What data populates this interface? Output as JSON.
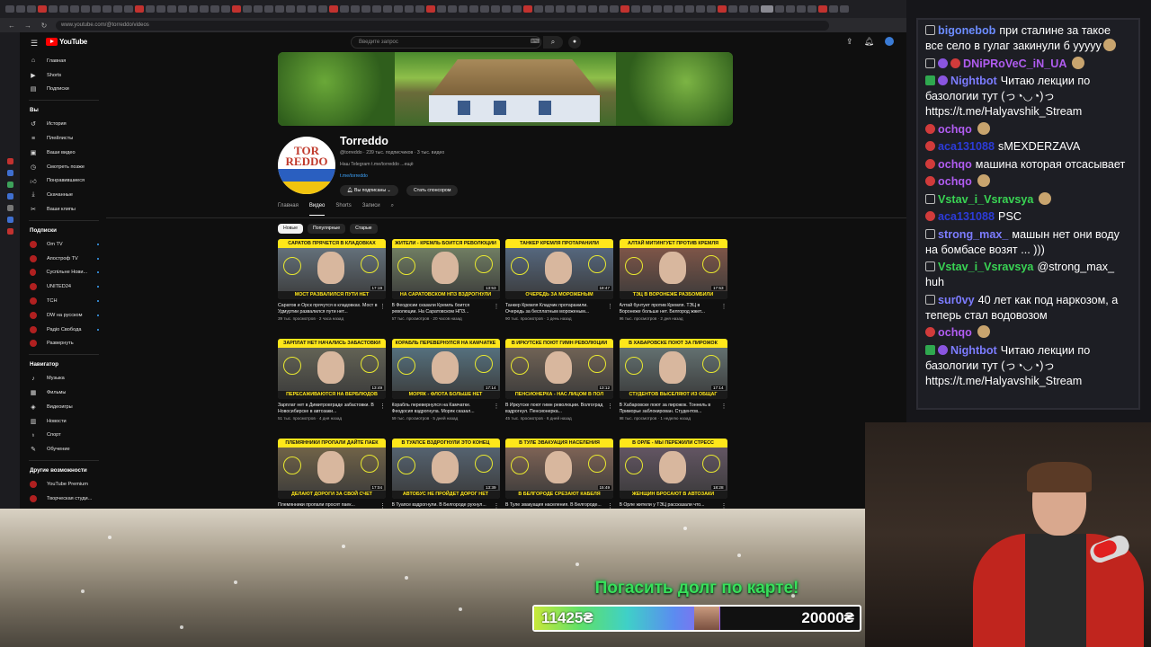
{
  "browser": {
    "url": "www.youtube.com/@torreddo/videos"
  },
  "youtube": {
    "logo_text": "YouTube",
    "search_placeholder": "Введите запрос",
    "sidebar": {
      "main": [
        {
          "label": "Главная",
          "icon": "home-icon"
        },
        {
          "label": "Shorts",
          "icon": "shorts-icon"
        },
        {
          "label": "Подписки",
          "icon": "subscriptions-icon"
        }
      ],
      "you_heading": "Вы",
      "you": [
        {
          "label": "История",
          "icon": "history-icon"
        },
        {
          "label": "Плейлисты",
          "icon": "playlists-icon"
        },
        {
          "label": "Ваши видео",
          "icon": "your-videos-icon"
        },
        {
          "label": "Смотреть позже",
          "icon": "watch-later-icon"
        },
        {
          "label": "Понравившиеся",
          "icon": "liked-icon"
        },
        {
          "label": "Скачанные",
          "icon": "downloads-icon"
        },
        {
          "label": "Ваши клипы",
          "icon": "clips-icon"
        }
      ],
      "subs_heading": "Подписки",
      "subs": [
        {
          "label": "Om TV"
        },
        {
          "label": "Апостроф TV"
        },
        {
          "label": "Суспільне Нови..."
        },
        {
          "label": "UNITED24"
        },
        {
          "label": "ТСН"
        },
        {
          "label": "DW на русском"
        },
        {
          "label": "Радіо Свобода"
        },
        {
          "label": "Развернуть"
        }
      ],
      "nav_heading": "Навигатор",
      "nav": [
        {
          "label": "Музыка",
          "icon": "music-icon"
        },
        {
          "label": "Фильмы",
          "icon": "movies-icon"
        },
        {
          "label": "Видеоигры",
          "icon": "gaming-icon"
        },
        {
          "label": "Новости",
          "icon": "news-icon"
        },
        {
          "label": "Спорт",
          "icon": "sports-icon"
        },
        {
          "label": "Обучение",
          "icon": "learning-icon"
        }
      ],
      "more_heading": "Другие возможности",
      "more": [
        {
          "label": "YouTube Premium"
        },
        {
          "label": "Творческая студи..."
        }
      ]
    },
    "channel": {
      "name": "Torreddo",
      "avatar_text": "TOR REDDO",
      "meta": "@torreddo · 239 тыс. подписчиков · 3 тыс. видео",
      "description": "Наш Telegram t.me/torreddo ...ещё",
      "link": "t.me/torreddo",
      "subscribed_label": "Вы подписаны",
      "sponsor_label": "Стать спонсором",
      "tabs": [
        "Главная",
        "Видео",
        "Shorts",
        "Записи"
      ],
      "active_tab": "Видео",
      "chips": [
        "Новые",
        "Популярные",
        "Старые"
      ]
    },
    "videos": [
      {
        "thumb_top": "САРАТОВ ПРЯЧЕТСЯ В КЛАДОВКАХ",
        "thumb_bottom": "МОСТ РАЗВАЛИЛСЯ ПУТИ НЕТ",
        "duration": "17:19",
        "title": "Саратов и Орск прячутся в кладовках. Мост в Удмуртии развалился пути нет...",
        "meta": "39 тыс. просмотров · 2 часа назад"
      },
      {
        "thumb_top": "ЖИТЕЛИ - КРЕМЛЬ БОИТСЯ РЕВОЛЮЦИИ",
        "thumb_bottom": "НА САРАТОВСКОМ НПЗ ВЗДРОГНУЛИ",
        "duration": "13:53",
        "title": "В Феодосии сказали Кремль боится революции. На Саратовском НПЗ...",
        "meta": "57 тыс. просмотров · 20 часов назад"
      },
      {
        "thumb_top": "ТАНКЕР КРЕМЛЯ ПРОТАРАНИЛИ",
        "thumb_bottom": "ОЧЕРЕДЬ ЗА МОРОЖЕНЫМ",
        "duration": "18:47",
        "title": "Танкер Кремля Кладчик протаранили. Очередь за бесплатным мороженым...",
        "meta": "90 тыс. просмотров · 1 день назад"
      },
      {
        "thumb_top": "АЛТАЙ МИТИНГУЕТ ПРОТИВ КРЕМЛЯ",
        "thumb_bottom": "ТЭЦ В ВОРОНЕЖЕ РАЗБОМБИЛИ",
        "duration": "17:53",
        "title": "Алтай бунтует против Кремля. ТЭЦ в Воронеже больше нет. Белгород жжет...",
        "meta": "96 тыс. просмотров · 2 дня назад"
      },
      {
        "thumb_top": "ЗАРПЛАТ НЕТ НАЧАЛИСЬ ЗАБАСТОВКИ",
        "thumb_bottom": "ПЕРЕСАЖИВАЮТСЯ НА ВЕРБЛЮДОВ",
        "duration": "13:49",
        "title": "Зарплат нет в Димитровграде забастовки. В Новосибирске в автозаки...",
        "meta": "51 тыс. просмотров · 4 дня назад"
      },
      {
        "thumb_top": "КОРАБЛЬ ПЕРЕВЕРНУЛСЯ НА КАМЧАТКЕ",
        "thumb_bottom": "МОРЯК - ФЛОТА БОЛЬШЕ НЕТ",
        "duration": "17:14",
        "title": "Корабль перевернулся на Камчатке. Феодосия вздрогнула. Моряк сказал...",
        "meta": "59 тыс. просмотров · 5 дней назад"
      },
      {
        "thumb_top": "В ИРКУТСКЕ ПОЮТ ГИМН РЕВОЛЮЦИИ",
        "thumb_bottom": "ПЕНСИОНЕРКА - НАС ЛИЦОМ В ПОЛ",
        "duration": "13:12",
        "title": "В Иркутске поют гимн революции. Волгоград вздрогнул. Пенсионерка...",
        "meta": "45 тыс. просмотров · 6 дней назад"
      },
      {
        "thumb_top": "В ХАБАРОВСКЕ ПОЮТ ЗА ПИРОЖОК",
        "thumb_bottom": "СТУДЕНТОВ ВЫСЕЛЯЮТ ИЗ ОБЩАГ",
        "duration": "17:14",
        "title": "В Хабаровске поют за пирожок. Тоннель в Приморье заблокирован. Студентов...",
        "meta": "98 тыс. просмотров · 1 неделю назад"
      },
      {
        "thumb_top": "ПЛЕМЯННИКИ ПРОПАЛИ ДАЙТЕ ПАЕК",
        "thumb_bottom": "ДЕЛАЮТ ДОРОГИ ЗА СВОЙ СЧЕТ",
        "duration": "17:04",
        "title": "Племянники пропали просят паек...",
        "meta": ""
      },
      {
        "thumb_top": "В ТУАПСЕ ВЗДРОГНУЛИ ЭТО КОНЕЦ",
        "thumb_bottom": "АВТОБУС НЕ ПРОЙДЕТ ДОРОГ НЕТ",
        "duration": "13:39",
        "title": "В Туапсе вздрогнули. В Белгороде рухнул...",
        "meta": ""
      },
      {
        "thumb_top": "В ТУЛЕ ЭВАКУАЦИЯ НАСЕЛЕНИЯ",
        "thumb_bottom": "В БЕЛГОРОДЕ СРЕЗАЮТ КАБЕЛЯ",
        "duration": "15:49",
        "title": "В Туле эвакуация населения. В Белгороде...",
        "meta": ""
      },
      {
        "thumb_top": "В ОРЛЕ - МЫ ПЕРЕЖИЛИ СТРЕСС",
        "thumb_bottom": "ЖЕНЩИН БРОСАЮТ В АВТОЗАКИ",
        "duration": "18:28",
        "title": "В Орле жители у ТЭЦ рассказали что...",
        "meta": ""
      }
    ]
  },
  "chat": {
    "messages": [
      {
        "user": "bigonebob",
        "color": "#6c8cff",
        "badge": "plain",
        "text": "при сталине за такое все село в гулаг закинули б ууууу"
      },
      {
        "user": "DNiPRoVeC_iN_UA",
        "color": "#b05cf0",
        "badge": "multi",
        "text": ""
      },
      {
        "user": "Nightbot",
        "color": "#7c7cff",
        "badge": "green",
        "text": "Читаю лекции по базологии тут (っ◔◡◔)っ https://t.me/Halyavshik_Stream"
      },
      {
        "user": "ochqo",
        "color": "#b05cf0",
        "badge": "red",
        "text": ""
      },
      {
        "user": "aca131088",
        "color": "#2c3bd8",
        "badge": "red",
        "text": "sMEXDERZAVA"
      },
      {
        "user": "ochqo",
        "color": "#b05cf0",
        "badge": "red",
        "text": "машина которая отсасывает"
      },
      {
        "user": "ochqo",
        "color": "#b05cf0",
        "badge": "red",
        "text": ""
      },
      {
        "user": "Vstav_i_Vsravsya",
        "color": "#39d353",
        "badge": "plain",
        "text": ""
      },
      {
        "user": "aca131088",
        "color": "#2c3bd8",
        "badge": "red",
        "text": "PSC"
      },
      {
        "user": "strong_max_",
        "color": "#7c7cff",
        "badge": "plain",
        "text": "машын нет они воду на бомбасе возят ... )))"
      },
      {
        "user": "Vstav_i_Vsravsya",
        "color": "#39d353",
        "badge": "plain",
        "text": "@strong_max_ huh"
      },
      {
        "user": "sur0vy",
        "color": "#7c7cff",
        "badge": "plain",
        "text": "40 лет как под наркозом, а теперь стал водовозом"
      },
      {
        "user": "ochqo",
        "color": "#b05cf0",
        "badge": "red",
        "text": ""
      },
      {
        "user": "Nightbot",
        "color": "#7c7cff",
        "badge": "green",
        "text": "Читаю лекции по базологии тут (っ◔◡◔)っ https://t.me/Halyavshik_Stream"
      }
    ]
  },
  "donation_goal": {
    "title": "Погасить долг по карте!",
    "current": "11425₴",
    "target": "20000₴",
    "progress": 0.571,
    "colors": [
      "#c8e83a",
      "#5ee06a",
      "#3fd0c8",
      "#5b8cf0",
      "#9b5cf0"
    ]
  }
}
